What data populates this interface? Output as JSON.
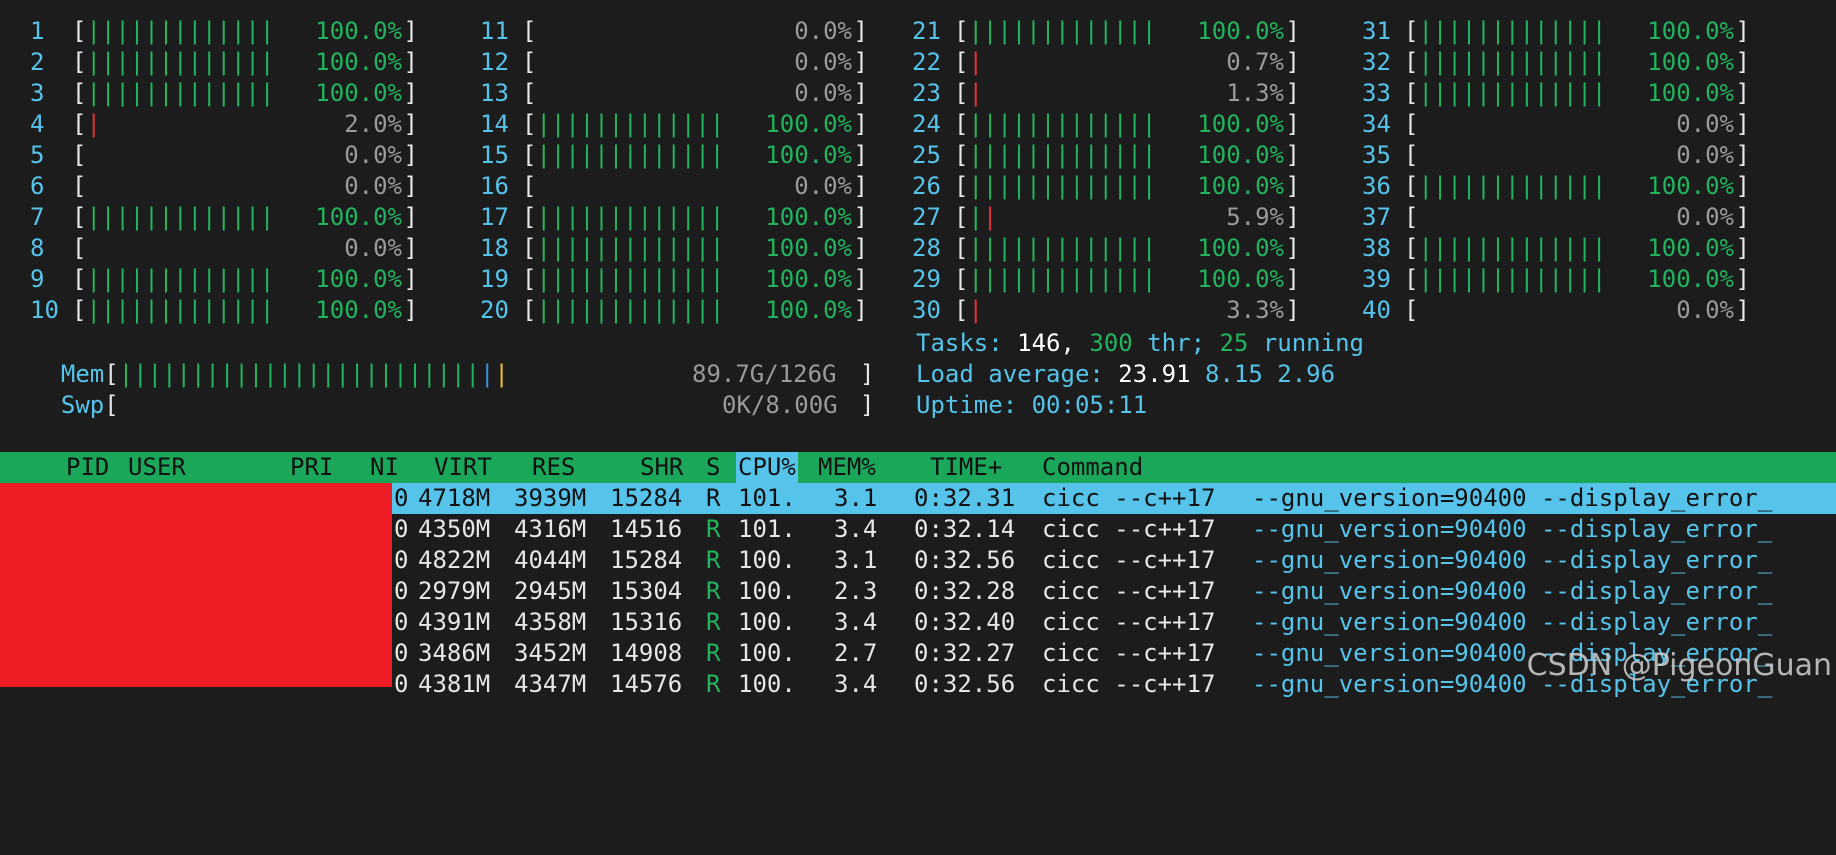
{
  "cpus": [
    {
      "id": "1",
      "pct": "100.0%",
      "fill": 1.0
    },
    {
      "id": "2",
      "pct": "100.0%",
      "fill": 1.0
    },
    {
      "id": "3",
      "pct": "100.0%",
      "fill": 1.0
    },
    {
      "id": "4",
      "pct": "2.0%",
      "fill": 0.02
    },
    {
      "id": "5",
      "pct": "0.0%",
      "fill": 0
    },
    {
      "id": "6",
      "pct": "0.0%",
      "fill": 0
    },
    {
      "id": "7",
      "pct": "100.0%",
      "fill": 1.0
    },
    {
      "id": "8",
      "pct": "0.0%",
      "fill": 0
    },
    {
      "id": "9",
      "pct": "100.0%",
      "fill": 1.0
    },
    {
      "id": "10",
      "pct": "100.0%",
      "fill": 1.0
    },
    {
      "id": "11",
      "pct": "0.0%",
      "fill": 0
    },
    {
      "id": "12",
      "pct": "0.0%",
      "fill": 0
    },
    {
      "id": "13",
      "pct": "0.0%",
      "fill": 0
    },
    {
      "id": "14",
      "pct": "100.0%",
      "fill": 1.0
    },
    {
      "id": "15",
      "pct": "100.0%",
      "fill": 1.0
    },
    {
      "id": "16",
      "pct": "0.0%",
      "fill": 0
    },
    {
      "id": "17",
      "pct": "100.0%",
      "fill": 1.0
    },
    {
      "id": "18",
      "pct": "100.0%",
      "fill": 1.0
    },
    {
      "id": "19",
      "pct": "100.0%",
      "fill": 1.0
    },
    {
      "id": "20",
      "pct": "100.0%",
      "fill": 1.0
    },
    {
      "id": "21",
      "pct": "100.0%",
      "fill": 1.0
    },
    {
      "id": "22",
      "pct": "0.7%",
      "fill": 0.007
    },
    {
      "id": "23",
      "pct": "1.3%",
      "fill": 0.013
    },
    {
      "id": "24",
      "pct": "100.0%",
      "fill": 1.0
    },
    {
      "id": "25",
      "pct": "100.0%",
      "fill": 1.0
    },
    {
      "id": "26",
      "pct": "100.0%",
      "fill": 1.0
    },
    {
      "id": "27",
      "pct": "5.9%",
      "fill": 0.059
    },
    {
      "id": "28",
      "pct": "100.0%",
      "fill": 1.0
    },
    {
      "id": "29",
      "pct": "100.0%",
      "fill": 1.0
    },
    {
      "id": "30",
      "pct": "3.3%",
      "fill": 0.033
    },
    {
      "id": "31",
      "pct": "100.0%",
      "fill": 1.0
    },
    {
      "id": "32",
      "pct": "100.0%",
      "fill": 1.0
    },
    {
      "id": "33",
      "pct": "100.0%",
      "fill": 1.0
    },
    {
      "id": "34",
      "pct": "0.0%",
      "fill": 0
    },
    {
      "id": "35",
      "pct": "0.0%",
      "fill": 0
    },
    {
      "id": "36",
      "pct": "100.0%",
      "fill": 1.0
    },
    {
      "id": "37",
      "pct": "0.0%",
      "fill": 0
    },
    {
      "id": "38",
      "pct": "100.0%",
      "fill": 1.0
    },
    {
      "id": "39",
      "pct": "100.0%",
      "fill": 1.0
    },
    {
      "id": "40",
      "pct": "0.0%",
      "fill": 0
    }
  ],
  "mem": {
    "label": "Mem",
    "value": "89.7G/126G",
    "fill": 0.712
  },
  "swp": {
    "label": "Swp",
    "value": "0K/8.00G",
    "fill": 0
  },
  "tasks": {
    "label": "Tasks:",
    "count": "146,",
    "thr": "300",
    "thr_label": "thr;",
    "running": "25",
    "running_label": "running"
  },
  "load": {
    "label": "Load average:",
    "v1": "23.91",
    "v2": "8.15",
    "v3": "2.96"
  },
  "uptime": {
    "label": "Uptime:",
    "value": "00:05:11"
  },
  "header": {
    "pid": "PID",
    "user": "USER",
    "pri": "PRI",
    "ni": "NI",
    "virt": "VIRT",
    "res": "RES",
    "shr": "SHR",
    "s": "S",
    "cpu": "CPU%",
    "mem": "MEM%",
    "time": "TIME+",
    "command": "Command"
  },
  "processes": [
    {
      "ni": "0",
      "virt": "4718M",
      "res": "3939M",
      "shr": "15284",
      "s": "R",
      "cpu": "101.",
      "mem": "3.1",
      "time": "0:32.31",
      "cmd": "cicc --c++17",
      "args": "--gnu_version=90400 --display_error_"
    },
    {
      "ni": "0",
      "virt": "4350M",
      "res": "4316M",
      "shr": "14516",
      "s": "R",
      "cpu": "101.",
      "mem": "3.4",
      "time": "0:32.14",
      "cmd": "cicc --c++17",
      "args": "--gnu_version=90400 --display_error_"
    },
    {
      "ni": "0",
      "virt": "4822M",
      "res": "4044M",
      "shr": "15284",
      "s": "R",
      "cpu": "100.",
      "mem": "3.1",
      "time": "0:32.56",
      "cmd": "cicc --c++17",
      "args": "--gnu_version=90400 --display_error_"
    },
    {
      "ni": "0",
      "virt": "2979M",
      "res": "2945M",
      "shr": "15304",
      "s": "R",
      "cpu": "100.",
      "mem": "2.3",
      "time": "0:32.28",
      "cmd": "cicc --c++17",
      "args": "--gnu_version=90400 --display_error_"
    },
    {
      "ni": "0",
      "virt": "4391M",
      "res": "4358M",
      "shr": "15316",
      "s": "R",
      "cpu": "100.",
      "mem": "3.4",
      "time": "0:32.40",
      "cmd": "cicc --c++17",
      "args": "--gnu_version=90400 --display_error_"
    },
    {
      "ni": "0",
      "virt": "3486M",
      "res": "3452M",
      "shr": "14908",
      "s": "R",
      "cpu": "100.",
      "mem": "2.7",
      "time": "0:32.27",
      "cmd": "cicc --c++17",
      "args": "--gnu_version=90400 --display_error_"
    },
    {
      "ni": "0",
      "virt": "4381M",
      "res": "4347M",
      "shr": "14576",
      "s": "R",
      "cpu": "100.",
      "mem": "3.4",
      "time": "0:32.56",
      "cmd": "cicc --c++17",
      "args": "--gnu_version=90400 --display_error_"
    }
  ],
  "watermark": "CSDN @PigeonGuan"
}
